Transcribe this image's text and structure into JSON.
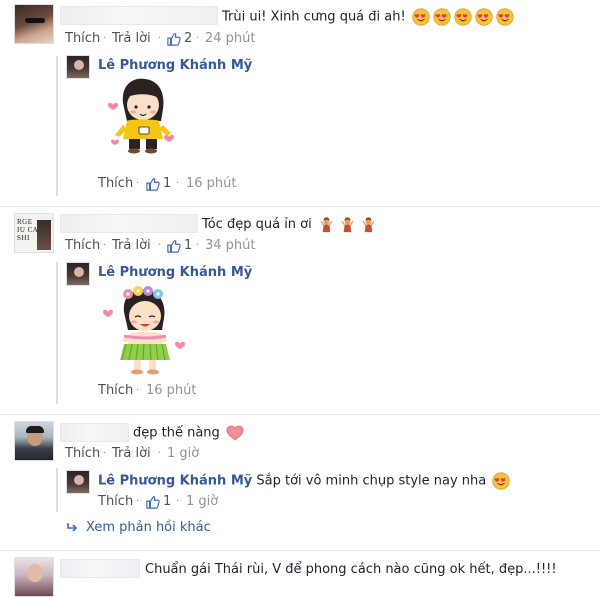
{
  "comments": [
    {
      "text": "Trùi ui! Xinh cưng quá đi ah!",
      "emoji": "heart-eyes-face-x5",
      "like_label": "Thích",
      "reply_label": "Trả lời",
      "like_count": "2",
      "time": "24 phút",
      "reply": {
        "author": "Lê Phương Khánh Mỹ",
        "sticker": "girl-in-yellow-shirt-with-hearts-sticker",
        "like_label": "Thích",
        "like_count": "1",
        "time": "16 phút"
      }
    },
    {
      "text": "Tóc đẹp quá ỉn ơi",
      "emoji": "raising-hands-emoji-x3",
      "like_label": "Thích",
      "reply_label": "Trả lời",
      "like_count": "1",
      "time": "34 phút",
      "reply": {
        "author": "Lê Phương Khánh Mỹ",
        "sticker": "hula-girl-with-flower-crown-sticker",
        "like_label": "Thích",
        "time": "16 phút"
      }
    },
    {
      "text": "đẹp thế nàng",
      "emoji": "heart-emoji",
      "like_label": "Thích",
      "reply_label": "Trả lời",
      "time": "1 giờ",
      "reply": {
        "author": "Lê Phương Khánh Mỹ",
        "text": "Sắp tới vô minh chụp style nay nha",
        "like_label": "Thích",
        "like_count": "1",
        "time": "1 giờ"
      },
      "more_replies": "Xem phản hồi khác"
    },
    {
      "text": "Chuẩn gái Thái rùi, V để phong cách nào cũng ok hết, đẹp...!!!!"
    }
  ],
  "colors": {
    "link_blue": "#365899",
    "like_blue": "#4267b2",
    "muted": "#90949c"
  }
}
